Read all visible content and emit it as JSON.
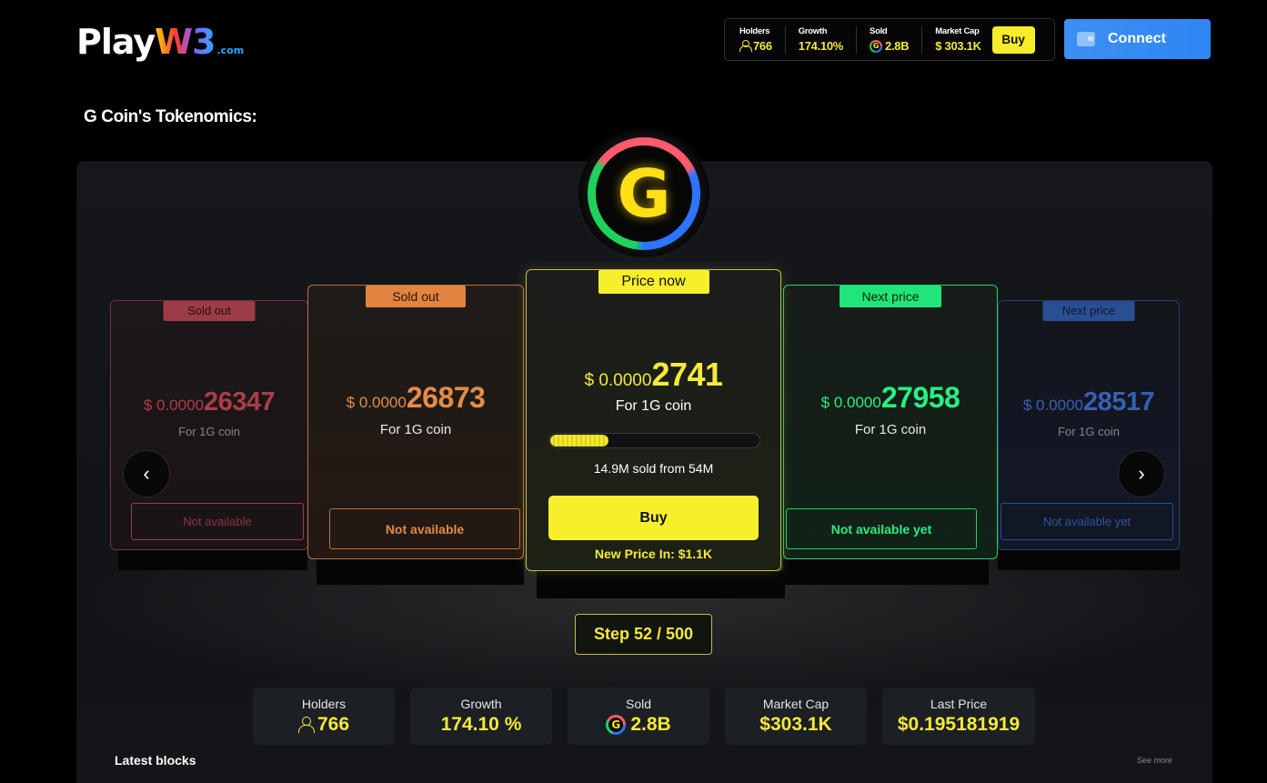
{
  "header": {
    "logo": {
      "play": "Play",
      "w3": "W3",
      "domain": ".com"
    },
    "stats": [
      {
        "label": "Holders",
        "value": "766",
        "icon": "person-icon"
      },
      {
        "label": "Growth",
        "value": "174.10%"
      },
      {
        "label": "Sold",
        "value": "2.8B",
        "icon": "g-coin-icon"
      },
      {
        "label": "Market Cap",
        "value": "$ 303.1K"
      }
    ],
    "buy_label": "Buy",
    "connect_label": "Connect"
  },
  "page_title": "G Coin's Tokenomics:",
  "coin": {
    "letter": "G"
  },
  "cards": [
    {
      "tag": "Sold out",
      "prefix": "$ 0.0000",
      "value": "26347",
      "unit": "For 1G coin",
      "status": "Not available",
      "color": "#c9444f"
    },
    {
      "tag": "Sold out",
      "prefix": "$ 0.0000",
      "value": "26873",
      "unit": "For 1G coin",
      "status": "Not available",
      "color": "#e38c4a"
    },
    {
      "tag": "Price now",
      "prefix": "$ 0.0000",
      "value": "2741",
      "unit": "For 1G coin",
      "sold_text": "14.9M sold from 54M",
      "progress": 0.276,
      "buy_label": "Buy",
      "new_price": "New Price In: $1.1K",
      "color": "#f5e93a"
    },
    {
      "tag": "Next price",
      "prefix": "$ 0.0000",
      "value": "27958",
      "unit": "For 1G coin",
      "status": "Not available yet",
      "color": "#2aee80"
    },
    {
      "tag": "Next price",
      "prefix": "$ 0.0000",
      "value": "28517",
      "unit": "For 1G coin",
      "status": "Not available yet",
      "color": "#3d6ed0"
    }
  ],
  "nav": {
    "prev_icon": "‹",
    "next_icon": "›"
  },
  "step": "Step 52 / 500",
  "summary": [
    {
      "label": "Holders",
      "value": "766",
      "icon": "person-icon"
    },
    {
      "label": "Growth",
      "value": "174.10 %"
    },
    {
      "label": "Sold",
      "value": "2.8B",
      "icon": "g-coin-icon"
    },
    {
      "label": "Market Cap",
      "value": "$303.1K"
    },
    {
      "label": "Last Price",
      "value": "$0.195181919"
    }
  ],
  "latest_blocks": "Latest blocks",
  "see_more": "See more",
  "colors": {
    "accent": "#f5e93a",
    "connect": "#3c8ff4"
  }
}
